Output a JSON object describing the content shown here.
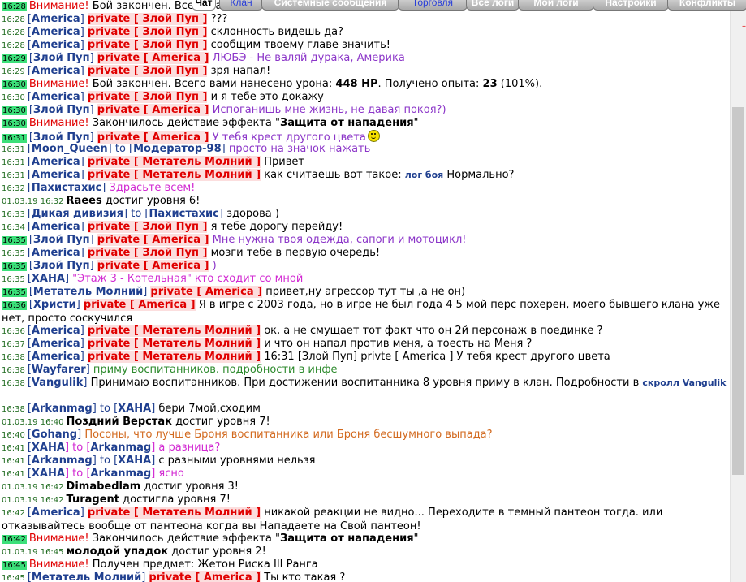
{
  "tabs": [
    {
      "label": "Чат",
      "active": true
    },
    {
      "label": "Клан",
      "color": "blue"
    },
    {
      "label": "Системные сообщения"
    },
    {
      "label": "Торговля",
      "color": "blue"
    },
    {
      "label": "Все логи"
    },
    {
      "label": "Мои логи"
    },
    {
      "label": "Настройки"
    },
    {
      "label": "Конфликты"
    }
  ],
  "corner_mark": "–",
  "lines": [
    {
      "ts": "16:28",
      "hl": true,
      "parts": [
        [
          "warn",
          "Внимание! "
        ],
        [
          "",
          "Бой закончен. Всего вами нанесено урона: "
        ]
      ]
    },
    {
      "ts": "16:28",
      "parts": [
        [
          "br",
          "["
        ],
        [
          "nick",
          "America"
        ],
        [
          "br",
          "] "
        ],
        [
          "priv",
          "private [ Злой Пуп ]"
        ],
        [
          "",
          " ???"
        ]
      ]
    },
    {
      "ts": "16:28",
      "parts": [
        [
          "br",
          "["
        ],
        [
          "nick",
          "America"
        ],
        [
          "br",
          "] "
        ],
        [
          "priv",
          "private [ Злой Пуп ]"
        ],
        [
          "",
          " склонность видешь да?"
        ]
      ]
    },
    {
      "ts": "16:28",
      "parts": [
        [
          "br",
          "["
        ],
        [
          "nick",
          "America"
        ],
        [
          "br",
          "] "
        ],
        [
          "priv",
          "private [ Злой Пуп ]"
        ],
        [
          "",
          " сообщим твоему главе значить!"
        ]
      ]
    },
    {
      "ts": "16:29",
      "hl": true,
      "parts": [
        [
          "br",
          "["
        ],
        [
          "nick",
          "Злой Пуп"
        ],
        [
          "br",
          "] "
        ],
        [
          "priv",
          "private [ America ]"
        ],
        [
          "purple",
          " ЛЮБЭ - Не валяй дурака, Америка"
        ]
      ]
    },
    {
      "ts": "16:29",
      "parts": [
        [
          "br",
          "["
        ],
        [
          "nick",
          "America"
        ],
        [
          "br",
          "] "
        ],
        [
          "priv",
          "private [ Злой Пуп ]"
        ],
        [
          "",
          " зря напал!"
        ]
      ]
    },
    {
      "ts": "16:30",
      "hl": true,
      "parts": [
        [
          "warn",
          "Внимание! "
        ],
        [
          "",
          "Бой закончен. Всего вами нанесено урона: "
        ],
        [
          "blk",
          "448 HP"
        ],
        [
          "",
          ". Получено опыта: "
        ],
        [
          "blk",
          "23"
        ],
        [
          "",
          " (101%)."
        ]
      ]
    },
    {
      "ts": "16:30",
      "parts": [
        [
          "br",
          "["
        ],
        [
          "nick",
          "America"
        ],
        [
          "br",
          "] "
        ],
        [
          "priv",
          "private [ Злой Пуп ]"
        ],
        [
          "",
          " и я тебе это докажу"
        ]
      ]
    },
    {
      "ts": "16:30",
      "hl": true,
      "parts": [
        [
          "br",
          "["
        ],
        [
          "nick",
          "Злой Пуп"
        ],
        [
          "br",
          "] "
        ],
        [
          "priv",
          "private [ America ]"
        ],
        [
          "purple",
          " Испоганишь мне жизнь, не давая покоя?)"
        ]
      ]
    },
    {
      "ts": "16:30",
      "hl": true,
      "parts": [
        [
          "warn",
          "Внимание! "
        ],
        [
          "",
          "Закончилось действие эффекта \""
        ],
        [
          "blk",
          "Защита от нападения"
        ],
        [
          "",
          "\""
        ]
      ]
    },
    {
      "ts": "16:31",
      "hl": true,
      "smile": true,
      "parts": [
        [
          "br",
          "["
        ],
        [
          "nick",
          "Злой Пуп"
        ],
        [
          "br",
          "] "
        ],
        [
          "priv",
          "private [ America ]"
        ],
        [
          "purple",
          " У тебя крест другого цвета"
        ]
      ]
    },
    {
      "ts": "16:31",
      "parts": [
        [
          "br",
          "["
        ],
        [
          "nick",
          "Moon_Queen"
        ],
        [
          "br",
          "] to ["
        ],
        [
          "nick",
          "Модератор-98"
        ],
        [
          "br",
          "] "
        ],
        [
          "purple",
          "просто на значок нажать"
        ]
      ]
    },
    {
      "ts": "16:31",
      "parts": [
        [
          "br",
          "["
        ],
        [
          "nick",
          "America"
        ],
        [
          "br",
          "] "
        ],
        [
          "priv",
          "private [ Метатель Молний ]"
        ],
        [
          "",
          " Привет"
        ]
      ]
    },
    {
      "ts": "16:31",
      "parts": [
        [
          "br",
          "["
        ],
        [
          "nick",
          "America"
        ],
        [
          "br",
          "] "
        ],
        [
          "priv",
          "private [ Метатель Молний ]"
        ],
        [
          "",
          " как считаешь вот такое: "
        ],
        [
          "link",
          "лог боя"
        ],
        [
          "",
          " Нормально?"
        ]
      ]
    },
    {
      "ts": "16:32",
      "parts": [
        [
          "br",
          "["
        ],
        [
          "nick",
          "Пахистахис"
        ],
        [
          "br",
          "] "
        ],
        [
          "magenta",
          "Здрасьте всем!"
        ]
      ]
    },
    {
      "ts": "01.03.19 16:32",
      "parts": [
        [
          "blk",
          "Raees"
        ],
        [
          "",
          " достиг уровня 6!"
        ]
      ]
    },
    {
      "ts": "16:33",
      "parts": [
        [
          "br",
          "["
        ],
        [
          "nick",
          "Дикая дивизия"
        ],
        [
          "br",
          "] to ["
        ],
        [
          "nick",
          "Пахистахис"
        ],
        [
          "br",
          "] "
        ],
        [
          "",
          "здорова )"
        ]
      ]
    },
    {
      "ts": "16:34",
      "parts": [
        [
          "br",
          "["
        ],
        [
          "nick",
          "America"
        ],
        [
          "br",
          "] "
        ],
        [
          "priv",
          "private [ Злой Пуп ]"
        ],
        [
          "",
          " я тебе дорогу перейду!"
        ]
      ]
    },
    {
      "ts": "16:35",
      "hl": true,
      "parts": [
        [
          "br",
          "["
        ],
        [
          "nick",
          "Злой Пуп"
        ],
        [
          "br",
          "] "
        ],
        [
          "priv",
          "private [ America ]"
        ],
        [
          "purple",
          " Мне нужна твоя одежда, сапоги и мотоцикл!"
        ]
      ]
    },
    {
      "ts": "16:35",
      "parts": [
        [
          "br",
          "["
        ],
        [
          "nick",
          "America"
        ],
        [
          "br",
          "] "
        ],
        [
          "priv",
          "private [ Злой Пуп ]"
        ],
        [
          "",
          " мозги тебе в первую очередь!"
        ]
      ]
    },
    {
      "ts": "16:35",
      "hl": true,
      "parts": [
        [
          "br",
          "["
        ],
        [
          "nick",
          "Злой Пуп"
        ],
        [
          "br",
          "] "
        ],
        [
          "priv",
          "private [ America ]"
        ],
        [
          "purple",
          " )"
        ]
      ]
    },
    {
      "ts": "16:35",
      "parts": [
        [
          "br",
          "["
        ],
        [
          "nick",
          "ХАНА"
        ],
        [
          "br",
          "] "
        ],
        [
          "magenta",
          "\"Этаж 3 - Котельная\" кто сходит со мной"
        ]
      ]
    },
    {
      "ts": "16:35",
      "hl": true,
      "parts": [
        [
          "br",
          "["
        ],
        [
          "nick",
          "Метатель Молний"
        ],
        [
          "br",
          "] "
        ],
        [
          "priv",
          "private [ America ]"
        ],
        [
          "",
          " привет,ну агрессор тут ты ,а не он)"
        ]
      ]
    },
    {
      "ts": "16:36",
      "hl": true,
      "wrap": true,
      "parts": [
        [
          "br",
          "["
        ],
        [
          "nick",
          "Христи"
        ],
        [
          "br",
          "] "
        ],
        [
          "priv",
          "private [ America ]"
        ],
        [
          "",
          " Я в игре с 2003 года, но в игре не был года 4 5 мой перс похерен, моего бывшего клана уже нет, просто соскучился"
        ]
      ]
    },
    {
      "ts": "16:36",
      "parts": [
        [
          "br",
          "["
        ],
        [
          "nick",
          "America"
        ],
        [
          "br",
          "] "
        ],
        [
          "priv",
          "private [ Метатель Молний ]"
        ],
        [
          "",
          " ок, а не смущает тот факт что он 2й персонаж в поединке ?"
        ]
      ]
    },
    {
      "ts": "16:37",
      "parts": [
        [
          "br",
          "["
        ],
        [
          "nick",
          "America"
        ],
        [
          "br",
          "] "
        ],
        [
          "priv",
          "private [ Метатель Молний ]"
        ],
        [
          "",
          " и что он напал против меня, а тоесть на Меня ?"
        ]
      ]
    },
    {
      "ts": "16:38",
      "parts": [
        [
          "br",
          "["
        ],
        [
          "nick",
          "America"
        ],
        [
          "br",
          "] "
        ],
        [
          "priv",
          "private [ Метатель Молний ]"
        ],
        [
          "",
          " 16:31 [Злой Пуп] privte [ America ] У тебя крест другого цвета"
        ]
      ]
    },
    {
      "ts": "16:38",
      "parts": [
        [
          "br",
          "["
        ],
        [
          "nick",
          "Wayfarer"
        ],
        [
          "br",
          "] "
        ],
        [
          "green",
          "приму воспитанников. подробности в инфе"
        ]
      ]
    },
    {
      "ts": "16:38",
      "wrap": true,
      "parts": [
        [
          "br",
          "["
        ],
        [
          "nick",
          "Vangulik"
        ],
        [
          "br",
          "] "
        ],
        [
          "",
          "Принимаю воспитанников. При достижении воспитанника 8 уровня приму в клан. Подробности в "
        ],
        [
          "link",
          "скролл Vangulik"
        ]
      ]
    },
    {
      "ts": "16:38",
      "parts": [
        [
          "br",
          "["
        ],
        [
          "nick",
          "Arkanmag"
        ],
        [
          "br",
          "] to ["
        ],
        [
          "nick",
          "ХАНА"
        ],
        [
          "br",
          "] "
        ],
        [
          "",
          "бери 7мой,сходим"
        ]
      ]
    },
    {
      "ts": "01.03.19 16:40",
      "parts": [
        [
          "blk",
          "Поздний Верстак"
        ],
        [
          "",
          " достиг уровня 7!"
        ]
      ]
    },
    {
      "ts": "16:40",
      "parts": [
        [
          "br",
          "["
        ],
        [
          "nick",
          "Gohang"
        ],
        [
          "br",
          "] "
        ],
        [
          "orange",
          "Посоны, что лучше Броня воспитанника или Броня бесшумного выпада?"
        ]
      ]
    },
    {
      "ts": "16:41",
      "parts": [
        [
          "br",
          "["
        ],
        [
          "nick",
          "ХАНА"
        ],
        [
          "magenta",
          "] to ["
        ],
        [
          "nick",
          "Arkanmag"
        ],
        [
          "magenta",
          "] а разница?"
        ]
      ]
    },
    {
      "ts": "16:41",
      "parts": [
        [
          "br",
          "["
        ],
        [
          "nick",
          "Arkanmag"
        ],
        [
          "br",
          "] to ["
        ],
        [
          "nick",
          "ХАНА"
        ],
        [
          "br",
          "] "
        ],
        [
          "",
          "с разными уровнями нельзя"
        ]
      ]
    },
    {
      "ts": "16:41",
      "parts": [
        [
          "br",
          "["
        ],
        [
          "nick",
          "ХАНА"
        ],
        [
          "magenta",
          "] to ["
        ],
        [
          "nick",
          "Arkanmag"
        ],
        [
          "magenta",
          "] ясно"
        ]
      ]
    },
    {
      "ts": "01.03.19 16:42",
      "parts": [
        [
          "blk",
          "Dimabedlam"
        ],
        [
          "",
          " достиг уровня 3!"
        ]
      ]
    },
    {
      "ts": "01.03.19 16:42",
      "parts": [
        [
          "blk",
          "Turagent"
        ],
        [
          "",
          " достигла уровня 7!"
        ]
      ]
    },
    {
      "ts": "16:42",
      "wrap": true,
      "parts": [
        [
          "br",
          "["
        ],
        [
          "nick",
          "America"
        ],
        [
          "br",
          "] "
        ],
        [
          "priv",
          "private [ Метатель Молний ]"
        ],
        [
          "",
          " никакой реакции не видно... Переходите в темный пантеон тогда. или отказывайтесь вообще от пантеона когда вы Нападаете на Свой пантеон!"
        ]
      ]
    },
    {
      "ts": "16:42",
      "hl": true,
      "parts": [
        [
          "warn",
          "Внимание! "
        ],
        [
          "",
          "Закончилось действие эффекта \""
        ],
        [
          "blk",
          "Защита от нападения"
        ],
        [
          "",
          "\""
        ]
      ]
    },
    {
      "ts": "01.03.19 16:45",
      "parts": [
        [
          "blk",
          "молодой упадок"
        ],
        [
          "",
          " достиг уровня 2!"
        ]
      ]
    },
    {
      "ts": "16:45",
      "hl": true,
      "parts": [
        [
          "warn",
          "Внимание! "
        ],
        [
          "",
          "Получен предмет: Жетон Риска III Ранга"
        ]
      ]
    },
    {
      "ts": "16:45",
      "parts": [
        [
          "br",
          "["
        ],
        [
          "nick",
          "Метатель Молний"
        ],
        [
          "br",
          "] "
        ],
        [
          "priv",
          "private [ America ]"
        ],
        [
          "",
          " Ты кто такая ?"
        ]
      ]
    }
  ]
}
